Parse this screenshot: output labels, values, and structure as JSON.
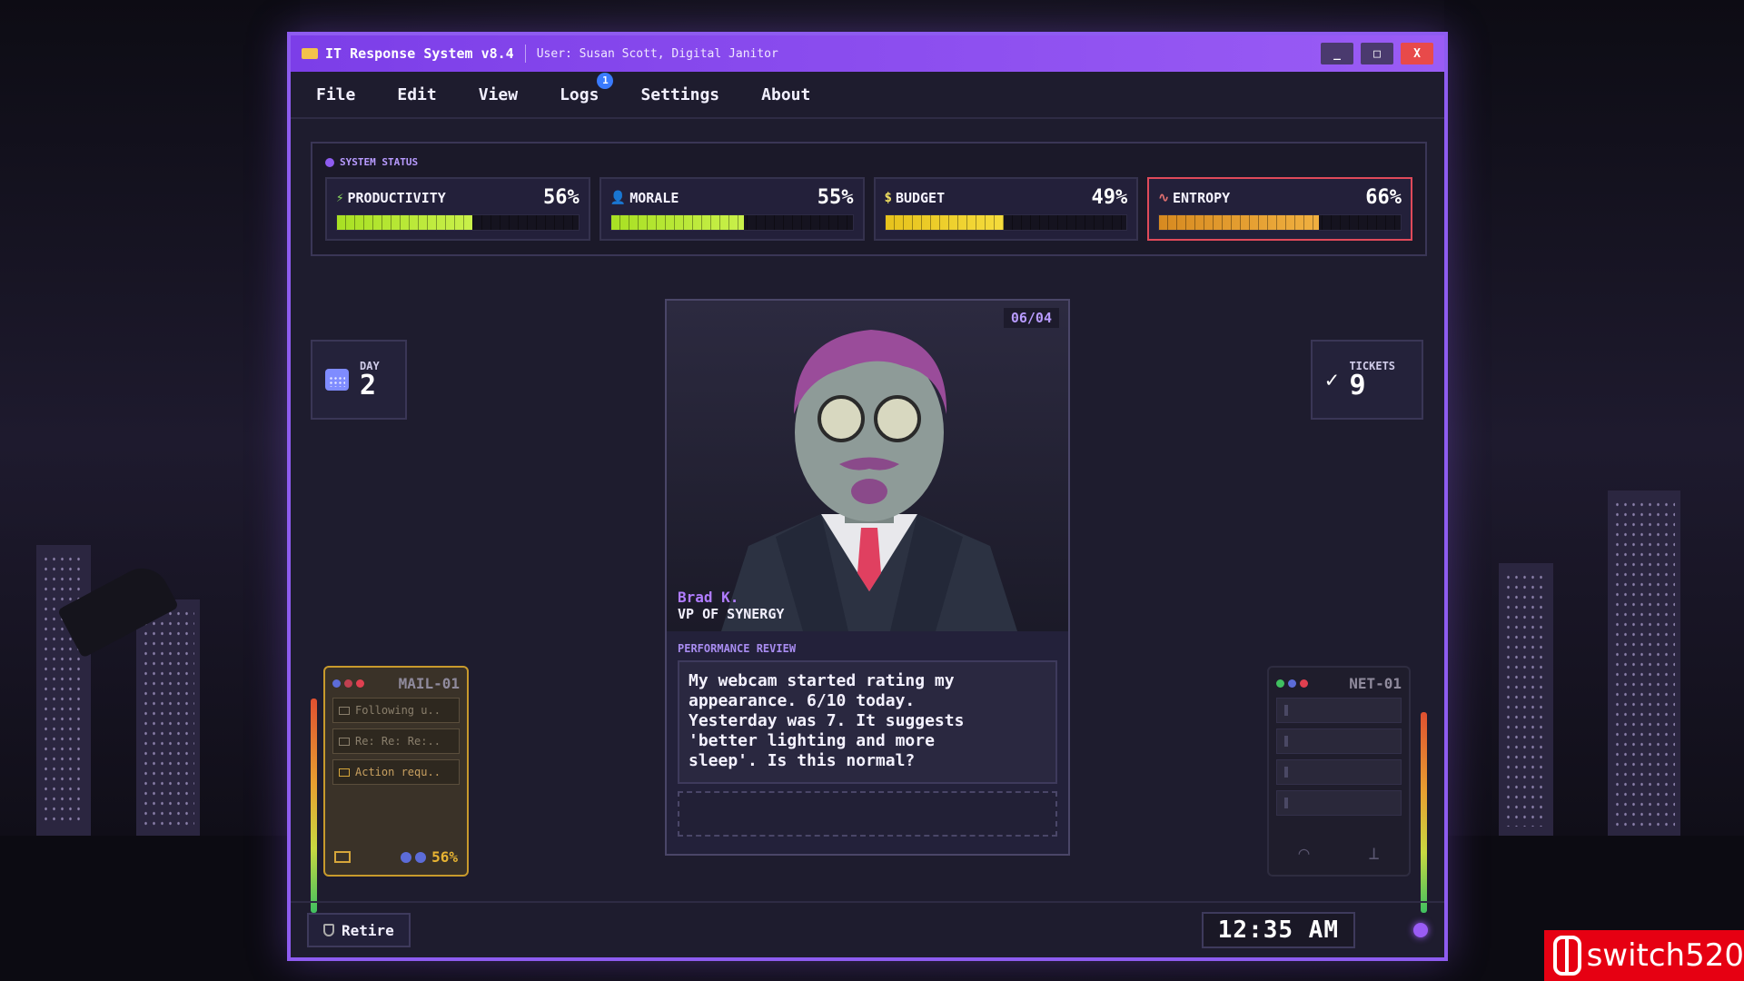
{
  "window": {
    "title": "IT Response System v8.4",
    "user": "User: Susan Scott, Digital Janitor",
    "controls": {
      "minimize": "_",
      "maximize": "□",
      "close": "X"
    }
  },
  "menu": [
    {
      "label": "File"
    },
    {
      "label": "Edit"
    },
    {
      "label": "View"
    },
    {
      "label": "Logs",
      "badge": "1"
    },
    {
      "label": "Settings"
    },
    {
      "label": "About"
    }
  ],
  "status": {
    "title": "SYSTEM STATUS",
    "meters": [
      {
        "label": "PRODUCTIVITY",
        "value_text": "56%",
        "value": 56,
        "icon": "bolt-icon",
        "color": "#a8e023"
      },
      {
        "label": "MORALE",
        "value_text": "55%",
        "value": 55,
        "icon": "people-icon",
        "color": "#a8e023"
      },
      {
        "label": "BUDGET",
        "value_text": "49%",
        "value": 49,
        "icon": "dollar-icon",
        "color": "#e6c21c"
      },
      {
        "label": "ENTROPY",
        "value_text": "66%",
        "value": 66,
        "icon": "pulse-icon",
        "color": "#e0a030",
        "alert": true
      }
    ]
  },
  "day": {
    "label": "DAY",
    "value": "2"
  },
  "tickets": {
    "label": "TICKETS",
    "value": "9"
  },
  "caller": {
    "date": "06/04",
    "name": "Brad K.",
    "role": "VP OF SYNERGY",
    "category": "PERFORMANCE REVIEW",
    "message": "My webcam started rating my\nappearance. 6/10 today.\nYesterday was 7. It suggests\n'better lighting and more\nsleep'. Is this normal?"
  },
  "mail": {
    "title": "MAIL-01",
    "items": [
      "Following u..",
      "Re: Re: Re:..",
      "Action requ.."
    ],
    "percent": "56%"
  },
  "net": {
    "title": "NET-01"
  },
  "footer": {
    "retire_label": "Retire",
    "clock": "12:35 AM"
  },
  "watermark": {
    "text": "switch520"
  }
}
